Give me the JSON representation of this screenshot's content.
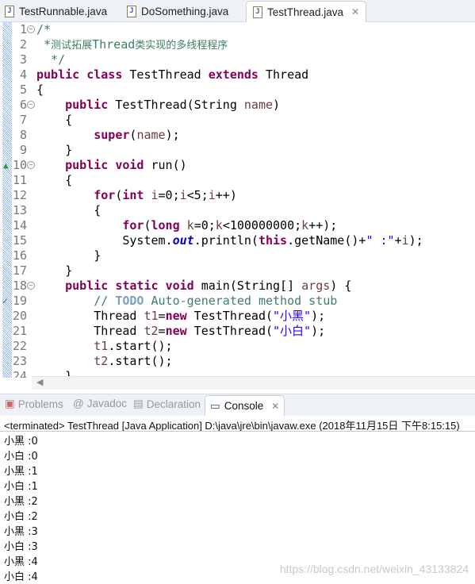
{
  "tabs": [
    {
      "label": "TestRunnable.java",
      "active": false
    },
    {
      "label": "DoSomething.java",
      "active": false
    },
    {
      "label": "TestThread.java",
      "active": true
    }
  ],
  "code": [
    {
      "n": "1",
      "fold": true,
      "t": [
        [
          "/*",
          "cm"
        ]
      ]
    },
    {
      "n": "2",
      "t": [
        [
          " *",
          "cm"
        ],
        [
          "测试拓展",
          "cmcn"
        ],
        [
          "Thread",
          "cm"
        ],
        [
          "类实现的多线程程序",
          "cmcn"
        ]
      ]
    },
    {
      "n": "3",
      "t": [
        [
          "  */",
          "cm"
        ]
      ]
    },
    {
      "n": "4",
      "t": [
        [
          "public",
          "kw"
        ],
        [
          " "
        ],
        [
          "class",
          "kw"
        ],
        [
          " TestThread "
        ],
        [
          "extends",
          "kw"
        ],
        [
          " Thread"
        ]
      ]
    },
    {
      "n": "5",
      "t": [
        [
          "{"
        ]
      ]
    },
    {
      "n": "6",
      "fold": true,
      "t": [
        [
          "    "
        ],
        [
          "public",
          "kw"
        ],
        [
          " TestThread(String "
        ],
        [
          "name",
          "var"
        ],
        [
          ")"
        ]
      ]
    },
    {
      "n": "7",
      "t": [
        [
          "    {"
        ]
      ]
    },
    {
      "n": "8",
      "t": [
        [
          "        "
        ],
        [
          "super",
          "kw"
        ],
        [
          "("
        ],
        [
          "name",
          "var"
        ],
        [
          ");"
        ]
      ]
    },
    {
      "n": "9",
      "t": [
        [
          "    }"
        ]
      ]
    },
    {
      "n": "10",
      "fold": true,
      "marker": "override",
      "t": [
        [
          "    "
        ],
        [
          "public",
          "kw"
        ],
        [
          " "
        ],
        [
          "void",
          "kw"
        ],
        [
          " run()"
        ]
      ]
    },
    {
      "n": "11",
      "t": [
        [
          "    {"
        ]
      ]
    },
    {
      "n": "12",
      "t": [
        [
          "        "
        ],
        [
          "for",
          "kw"
        ],
        [
          "("
        ],
        [
          "int",
          "kw"
        ],
        [
          " "
        ],
        [
          "i",
          "var"
        ],
        [
          "=0;"
        ],
        [
          "i",
          "var"
        ],
        [
          "<5;"
        ],
        [
          "i",
          "var"
        ],
        [
          "++)"
        ]
      ]
    },
    {
      "n": "13",
      "t": [
        [
          "        {"
        ]
      ]
    },
    {
      "n": "14",
      "t": [
        [
          "            "
        ],
        [
          "for",
          "kw"
        ],
        [
          "("
        ],
        [
          "long",
          "kw"
        ],
        [
          " "
        ],
        [
          "k",
          "var"
        ],
        [
          "=0;"
        ],
        [
          "k",
          "var"
        ],
        [
          "<100000000;"
        ],
        [
          "k",
          "var"
        ],
        [
          "++);"
        ]
      ]
    },
    {
      "n": "15",
      "t": [
        [
          "            System."
        ],
        [
          "out",
          "fld"
        ],
        [
          ".println("
        ],
        [
          "this",
          "kw"
        ],
        [
          ".getName()+"
        ],
        [
          "\" :\"",
          "str"
        ],
        [
          "+"
        ],
        [
          "i",
          "var"
        ],
        [
          ");"
        ]
      ]
    },
    {
      "n": "16",
      "t": [
        [
          "        }"
        ]
      ]
    },
    {
      "n": "17",
      "t": [
        [
          "    }"
        ]
      ]
    },
    {
      "n": "18",
      "fold": true,
      "t": [
        [
          "    "
        ],
        [
          "public",
          "kw"
        ],
        [
          " "
        ],
        [
          "static",
          "kw"
        ],
        [
          " "
        ],
        [
          "void",
          "kw"
        ],
        [
          " main(String[] "
        ],
        [
          "args",
          "var"
        ],
        [
          ") {"
        ]
      ]
    },
    {
      "n": "19",
      "marker": "task",
      "t": [
        [
          "        "
        ],
        [
          "// ",
          "cm"
        ],
        [
          "TODO",
          "todo"
        ],
        [
          " Auto-generated method stub",
          "cm"
        ]
      ]
    },
    {
      "n": "20",
      "t": [
        [
          "        Thread "
        ],
        [
          "t1",
          "var"
        ],
        [
          "="
        ],
        [
          "new",
          "kw"
        ],
        [
          " TestThread("
        ],
        [
          "\"小黑\"",
          "str"
        ],
        [
          ");"
        ]
      ]
    },
    {
      "n": "21",
      "t": [
        [
          "        Thread "
        ],
        [
          "t2",
          "var"
        ],
        [
          "="
        ],
        [
          "new",
          "kw"
        ],
        [
          " TestThread("
        ],
        [
          "\"小白\"",
          "str"
        ],
        [
          ");"
        ]
      ]
    },
    {
      "n": "22",
      "t": [
        [
          "        "
        ],
        [
          "t1",
          "var"
        ],
        [
          ".start();"
        ]
      ]
    },
    {
      "n": "23",
      "t": [
        [
          "        "
        ],
        [
          "t2",
          "var"
        ],
        [
          ".start();"
        ]
      ]
    },
    {
      "n": "24",
      "t": [
        [
          "    }"
        ]
      ]
    }
  ],
  "panel": {
    "tabs": [
      {
        "label": "Problems"
      },
      {
        "label": "Javadoc"
      },
      {
        "label": "Declaration"
      },
      {
        "label": "Console"
      }
    ],
    "status": "<terminated> TestThread [Java Application] D:\\java\\jre\\bin\\javaw.exe (2018年11月15日 下午8:15:15)",
    "output": [
      "小黑 :0",
      "小白 :0",
      "小黑 :1",
      "小白 :1",
      "小黑 :2",
      "小白 :2",
      "小黑 :3",
      "小白 :3",
      "小黑 :4",
      "小白 :4"
    ]
  },
  "watermark": "https://blog.csdn.net/weixin_43133824"
}
